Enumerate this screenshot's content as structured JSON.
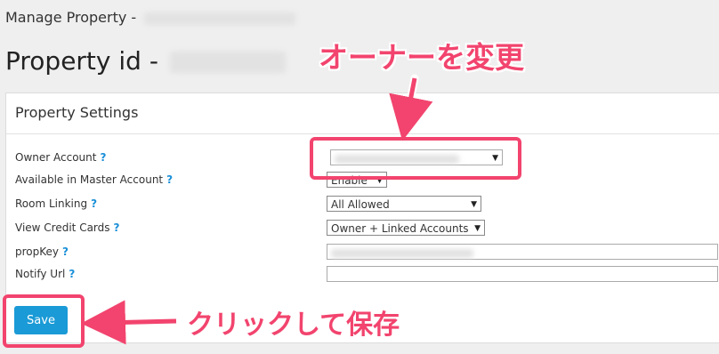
{
  "header": {
    "breadcrumb": "Manage Property - ",
    "title": "Property id - "
  },
  "panel": {
    "title": "Property Settings",
    "help_glyph": "?",
    "fields": [
      {
        "label": "Owner Account",
        "value": ""
      },
      {
        "label": "Available in Master Account",
        "value": "Enable"
      },
      {
        "label": "Room Linking",
        "value": "All Allowed"
      },
      {
        "label": "View Credit Cards",
        "value": "Owner + Linked Accounts"
      },
      {
        "label": "propKey",
        "value": ""
      },
      {
        "label": "Notify Url",
        "value": ""
      }
    ],
    "save_label": "Save"
  },
  "annotations": {
    "change_owner": "オーナーを変更",
    "click_to_save": "クリックして保存"
  },
  "colors": {
    "accent": "#f2446e",
    "button": "#1a9ad6",
    "help": "#1a8fd8"
  }
}
